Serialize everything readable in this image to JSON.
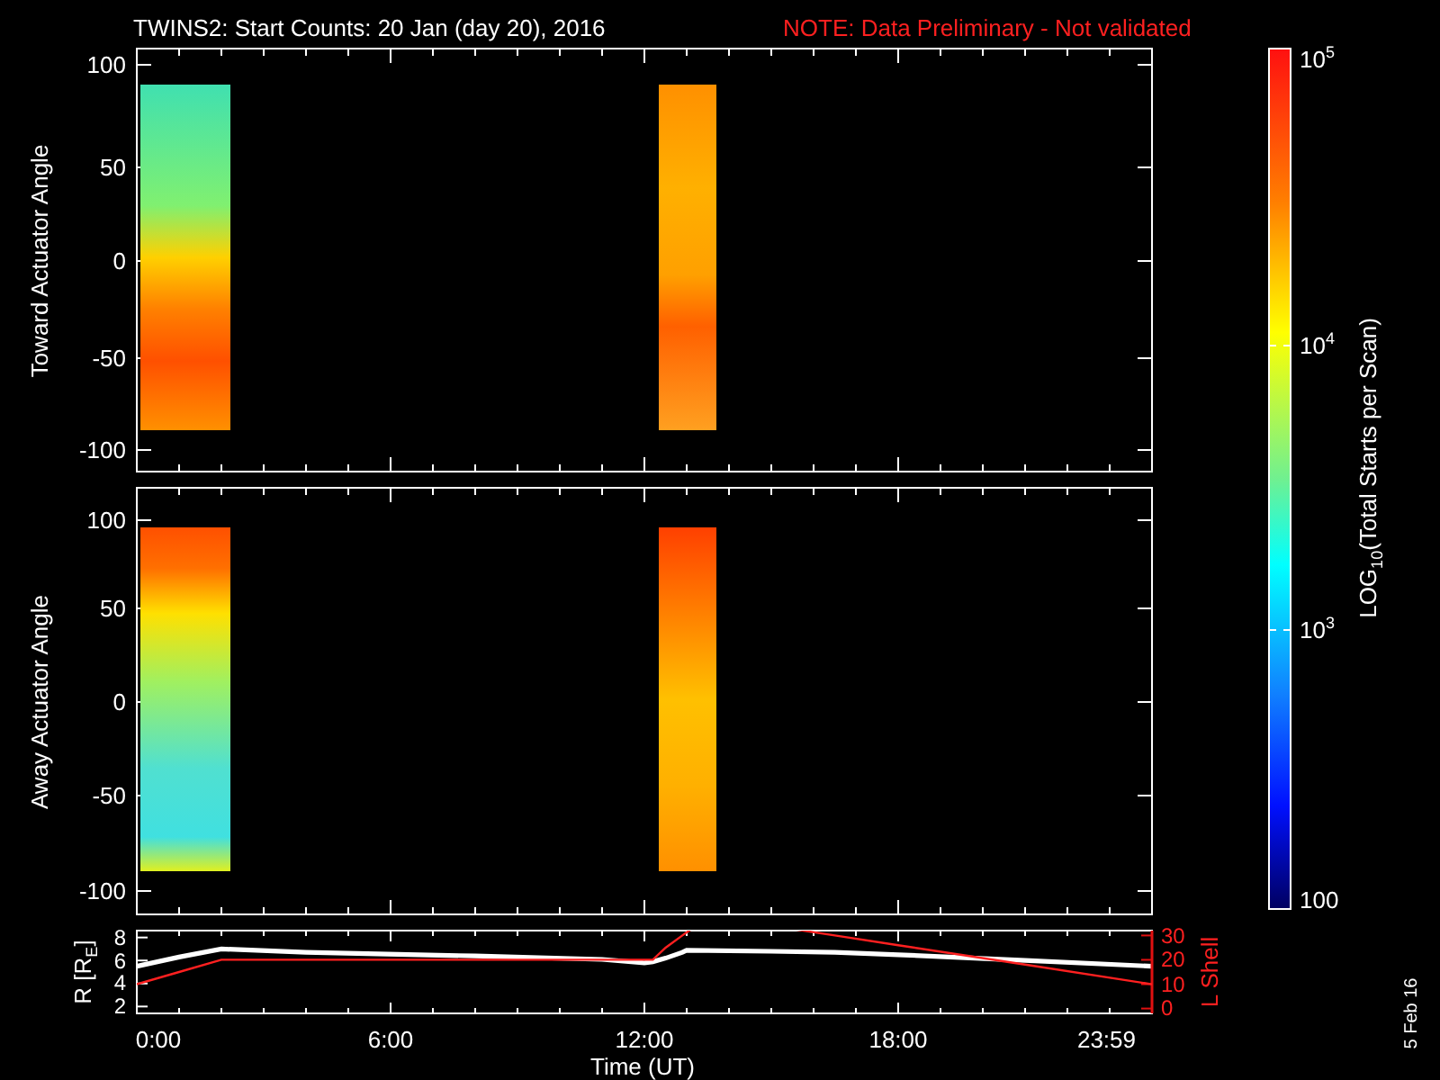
{
  "title": {
    "text": "TWINS2: Start Counts: 20 Jan (day  20), 2016",
    "note": "NOTE: Data Preliminary - Not validated"
  },
  "panels": [
    {
      "kind": "spectrogram",
      "ylabel": "Toward Actuator Angle",
      "yticks": [
        "100",
        "50",
        "0",
        "-50",
        "-100"
      ]
    },
    {
      "kind": "spectrogram",
      "ylabel": "Away Actuator Angle",
      "yticks": [
        "100",
        "50",
        "0",
        "-50",
        "-100"
      ]
    }
  ],
  "orbit_panel": {
    "chart_data": {
      "type": "line",
      "xlabel": "Time (UT)",
      "ylabel": "R [R$_{E}$]",
      "x": [
        0,
        1,
        2,
        4,
        8,
        11,
        12,
        12.2,
        12.5,
        12.9,
        13,
        15,
        16.5,
        18,
        21,
        24
      ],
      "series": [
        {
          "color": "#ffffff",
          "values": [
            5.5,
            6.3,
            7,
            6.7,
            6.4,
            6.1,
            5.8,
            5.9,
            6.2,
            6.7,
            6.9,
            6.8,
            6.7,
            6.5,
            6.0,
            5.5
          ]
        }
      ],
      "xlim": [
        0,
        24
      ],
      "ylim": [
        1.4,
        8.6
      ],
      "xticks": [
        {
          "value": 0,
          "label": "0:00"
        },
        {
          "value": 6,
          "label": "6:00"
        },
        {
          "value": 12,
          "label": "12:00"
        },
        {
          "value": 18,
          "label": "18:00"
        },
        {
          "value": 23.99,
          "label": "23:59"
        }
      ],
      "yticks": [
        8,
        6,
        4,
        2
      ]
    },
    "l_shell_chart": {
      "chart_data": {
        "type": "line",
        "ylabel": "L Shell",
        "x": [
          0,
          1,
          2,
          4,
          8,
          11,
          12,
          12.2,
          12.5,
          12.9,
          14.7,
          16.5,
          18,
          21,
          24
        ],
        "series": [
          {
            "color": "#ff2020",
            "values": [
              10,
              15,
              20,
              20,
              20,
              20,
              20,
              20,
              25,
              30,
              null,
              30,
              26,
              18,
              10
            ]
          }
        ],
        "xlim": [
          0,
          24
        ],
        "ylim": [
          -2,
          32
        ],
        "yticks": [
          30,
          20,
          10,
          0
        ]
      }
    }
  },
  "colorbar": {
    "label": "LOG$_{10}$(Total Starts per Scan)",
    "ticks": [
      "10$^{5}$",
      "10$^{4}$",
      "10$^{3}$",
      "100"
    ]
  },
  "date": "5 Feb 16"
}
